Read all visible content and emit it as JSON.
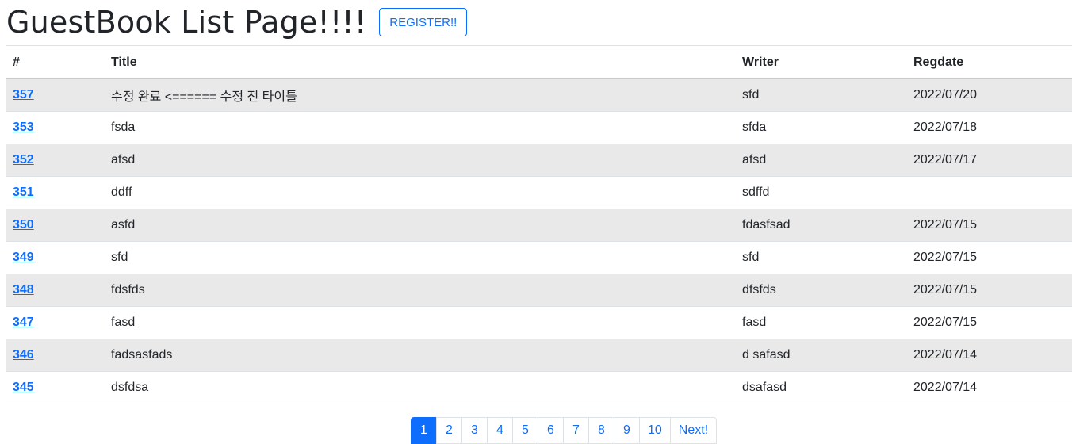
{
  "header": {
    "title": "GuestBook List Page!!!!",
    "register_label": "REGISTER!!"
  },
  "table": {
    "headers": {
      "num": "#",
      "title": "Title",
      "writer": "Writer",
      "regdate": "Regdate"
    },
    "rows": [
      {
        "gno": "357",
        "title": "수정 완료 <====== 수정 전 타이틀",
        "writer": "sfd",
        "regdate": "2022/07/20"
      },
      {
        "gno": "353",
        "title": "fsda",
        "writer": "sfda",
        "regdate": "2022/07/18"
      },
      {
        "gno": "352",
        "title": "afsd",
        "writer": "afsd",
        "regdate": "2022/07/17"
      },
      {
        "gno": "351",
        "title": "ddff",
        "writer": "sdffd",
        "regdate": ""
      },
      {
        "gno": "350",
        "title": "asfd",
        "writer": "fdasfsad",
        "regdate": "2022/07/15"
      },
      {
        "gno": "349",
        "title": "sfd",
        "writer": "sfd",
        "regdate": "2022/07/15"
      },
      {
        "gno": "348",
        "title": "fdsfds",
        "writer": "dfsfds",
        "regdate": "2022/07/15"
      },
      {
        "gno": "347",
        "title": "fasd",
        "writer": "fasd",
        "regdate": "2022/07/15"
      },
      {
        "gno": "346",
        "title": "fadsasfads",
        "writer": "d safasd",
        "regdate": "2022/07/14"
      },
      {
        "gno": "345",
        "title": "dsfdsa",
        "writer": "dsafasd",
        "regdate": "2022/07/14"
      }
    ]
  },
  "pagination": {
    "pages": [
      "1",
      "2",
      "3",
      "4",
      "5",
      "6",
      "7",
      "8",
      "9",
      "10"
    ],
    "active": "1",
    "next_label": "Next!"
  }
}
